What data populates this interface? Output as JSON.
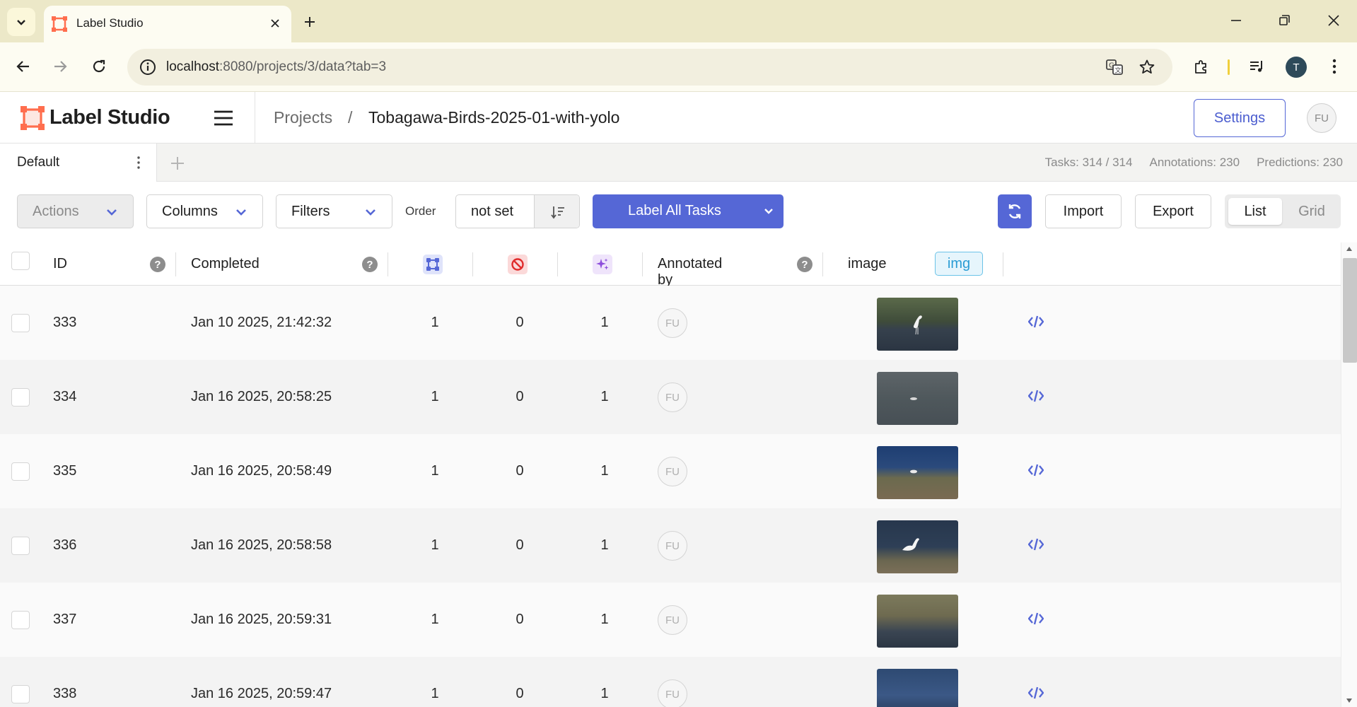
{
  "browser": {
    "tab_title": "Label Studio",
    "url_host": "localhost",
    "url_rest": ":8080/projects/3/data?tab=3",
    "profile_initial": "T",
    "icons": [
      "tab-search-icon",
      "favicon-icon",
      "close-icon",
      "plus-icon",
      "minimize-icon",
      "restore-icon",
      "window-close-icon",
      "back-icon",
      "forward-icon",
      "reload-icon",
      "info-icon",
      "translate-icon",
      "star-icon",
      "extensions-icon",
      "media-icon",
      "menu-dots-icon"
    ]
  },
  "header": {
    "logo_text": "Label Studio",
    "breadcrumb_projects": "Projects",
    "breadcrumb_sep": "/",
    "project_name": "Tobagawa-Birds-2025-01-with-yolo",
    "settings_label": "Settings",
    "user_initials": "FU",
    "brand_color": "#ff6e4e"
  },
  "view_tabs": {
    "active_tab": "Default",
    "tasks": "Tasks: 314 / 314",
    "annotations": "Annotations: 230",
    "predictions": "Predictions: 230"
  },
  "toolbar": {
    "actions_label": "Actions",
    "columns_label": "Columns",
    "filters_label": "Filters",
    "order_label": "Order",
    "order_value": "not set",
    "label_all_label": "Label All Tasks",
    "import_label": "Import",
    "export_label": "Export",
    "view_list": "List",
    "view_grid": "Grid",
    "accent": "#5567d6"
  },
  "table": {
    "columns": {
      "id": "ID",
      "completed": "Completed",
      "annotated_by": "Annotated by",
      "image": "image",
      "image_tag": "img",
      "help": "?"
    },
    "rows": [
      {
        "id": "333",
        "completed": "Jan 10 2025, 21:42:32",
        "annotations": "1",
        "cancelled": "0",
        "predictions": "1",
        "annotator": "FU"
      },
      {
        "id": "334",
        "completed": "Jan 16 2025, 20:58:25",
        "annotations": "1",
        "cancelled": "0",
        "predictions": "1",
        "annotator": "FU"
      },
      {
        "id": "335",
        "completed": "Jan 16 2025, 20:58:49",
        "annotations": "1",
        "cancelled": "0",
        "predictions": "1",
        "annotator": "FU"
      },
      {
        "id": "336",
        "completed": "Jan 16 2025, 20:58:58",
        "annotations": "1",
        "cancelled": "0",
        "predictions": "1",
        "annotator": "FU"
      },
      {
        "id": "337",
        "completed": "Jan 16 2025, 20:59:31",
        "annotations": "1",
        "cancelled": "0",
        "predictions": "1",
        "annotator": "FU"
      },
      {
        "id": "338",
        "completed": "Jan 16 2025, 20:59:47",
        "annotations": "1",
        "cancelled": "0",
        "predictions": "1",
        "annotator": "FU"
      }
    ]
  }
}
